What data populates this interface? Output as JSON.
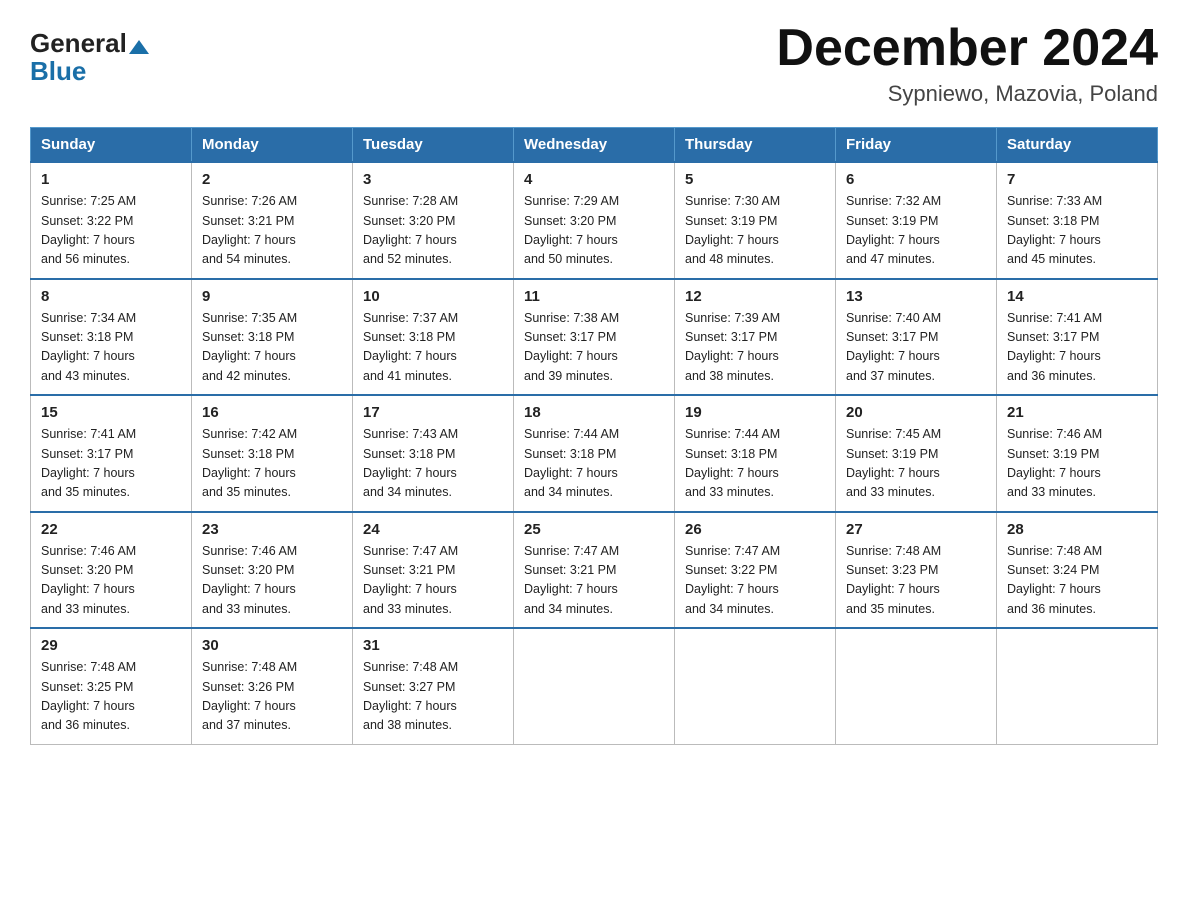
{
  "header": {
    "logo_general": "General",
    "logo_blue": "Blue",
    "month_title": "December 2024",
    "location": "Sypniewo, Mazovia, Poland"
  },
  "days_of_week": [
    "Sunday",
    "Monday",
    "Tuesday",
    "Wednesday",
    "Thursday",
    "Friday",
    "Saturday"
  ],
  "weeks": [
    [
      {
        "day": "1",
        "sunrise": "7:25 AM",
        "sunset": "3:22 PM",
        "daylight": "7 hours and 56 minutes."
      },
      {
        "day": "2",
        "sunrise": "7:26 AM",
        "sunset": "3:21 PM",
        "daylight": "7 hours and 54 minutes."
      },
      {
        "day": "3",
        "sunrise": "7:28 AM",
        "sunset": "3:20 PM",
        "daylight": "7 hours and 52 minutes."
      },
      {
        "day": "4",
        "sunrise": "7:29 AM",
        "sunset": "3:20 PM",
        "daylight": "7 hours and 50 minutes."
      },
      {
        "day": "5",
        "sunrise": "7:30 AM",
        "sunset": "3:19 PM",
        "daylight": "7 hours and 48 minutes."
      },
      {
        "day": "6",
        "sunrise": "7:32 AM",
        "sunset": "3:19 PM",
        "daylight": "7 hours and 47 minutes."
      },
      {
        "day": "7",
        "sunrise": "7:33 AM",
        "sunset": "3:18 PM",
        "daylight": "7 hours and 45 minutes."
      }
    ],
    [
      {
        "day": "8",
        "sunrise": "7:34 AM",
        "sunset": "3:18 PM",
        "daylight": "7 hours and 43 minutes."
      },
      {
        "day": "9",
        "sunrise": "7:35 AM",
        "sunset": "3:18 PM",
        "daylight": "7 hours and 42 minutes."
      },
      {
        "day": "10",
        "sunrise": "7:37 AM",
        "sunset": "3:18 PM",
        "daylight": "7 hours and 41 minutes."
      },
      {
        "day": "11",
        "sunrise": "7:38 AM",
        "sunset": "3:17 PM",
        "daylight": "7 hours and 39 minutes."
      },
      {
        "day": "12",
        "sunrise": "7:39 AM",
        "sunset": "3:17 PM",
        "daylight": "7 hours and 38 minutes."
      },
      {
        "day": "13",
        "sunrise": "7:40 AM",
        "sunset": "3:17 PM",
        "daylight": "7 hours and 37 minutes."
      },
      {
        "day": "14",
        "sunrise": "7:41 AM",
        "sunset": "3:17 PM",
        "daylight": "7 hours and 36 minutes."
      }
    ],
    [
      {
        "day": "15",
        "sunrise": "7:41 AM",
        "sunset": "3:17 PM",
        "daylight": "7 hours and 35 minutes."
      },
      {
        "day": "16",
        "sunrise": "7:42 AM",
        "sunset": "3:18 PM",
        "daylight": "7 hours and 35 minutes."
      },
      {
        "day": "17",
        "sunrise": "7:43 AM",
        "sunset": "3:18 PM",
        "daylight": "7 hours and 34 minutes."
      },
      {
        "day": "18",
        "sunrise": "7:44 AM",
        "sunset": "3:18 PM",
        "daylight": "7 hours and 34 minutes."
      },
      {
        "day": "19",
        "sunrise": "7:44 AM",
        "sunset": "3:18 PM",
        "daylight": "7 hours and 33 minutes."
      },
      {
        "day": "20",
        "sunrise": "7:45 AM",
        "sunset": "3:19 PM",
        "daylight": "7 hours and 33 minutes."
      },
      {
        "day": "21",
        "sunrise": "7:46 AM",
        "sunset": "3:19 PM",
        "daylight": "7 hours and 33 minutes."
      }
    ],
    [
      {
        "day": "22",
        "sunrise": "7:46 AM",
        "sunset": "3:20 PM",
        "daylight": "7 hours and 33 minutes."
      },
      {
        "day": "23",
        "sunrise": "7:46 AM",
        "sunset": "3:20 PM",
        "daylight": "7 hours and 33 minutes."
      },
      {
        "day": "24",
        "sunrise": "7:47 AM",
        "sunset": "3:21 PM",
        "daylight": "7 hours and 33 minutes."
      },
      {
        "day": "25",
        "sunrise": "7:47 AM",
        "sunset": "3:21 PM",
        "daylight": "7 hours and 34 minutes."
      },
      {
        "day": "26",
        "sunrise": "7:47 AM",
        "sunset": "3:22 PM",
        "daylight": "7 hours and 34 minutes."
      },
      {
        "day": "27",
        "sunrise": "7:48 AM",
        "sunset": "3:23 PM",
        "daylight": "7 hours and 35 minutes."
      },
      {
        "day": "28",
        "sunrise": "7:48 AM",
        "sunset": "3:24 PM",
        "daylight": "7 hours and 36 minutes."
      }
    ],
    [
      {
        "day": "29",
        "sunrise": "7:48 AM",
        "sunset": "3:25 PM",
        "daylight": "7 hours and 36 minutes."
      },
      {
        "day": "30",
        "sunrise": "7:48 AM",
        "sunset": "3:26 PM",
        "daylight": "7 hours and 37 minutes."
      },
      {
        "day": "31",
        "sunrise": "7:48 AM",
        "sunset": "3:27 PM",
        "daylight": "7 hours and 38 minutes."
      },
      null,
      null,
      null,
      null
    ]
  ],
  "labels": {
    "sunrise": "Sunrise:",
    "sunset": "Sunset:",
    "daylight": "Daylight:"
  }
}
